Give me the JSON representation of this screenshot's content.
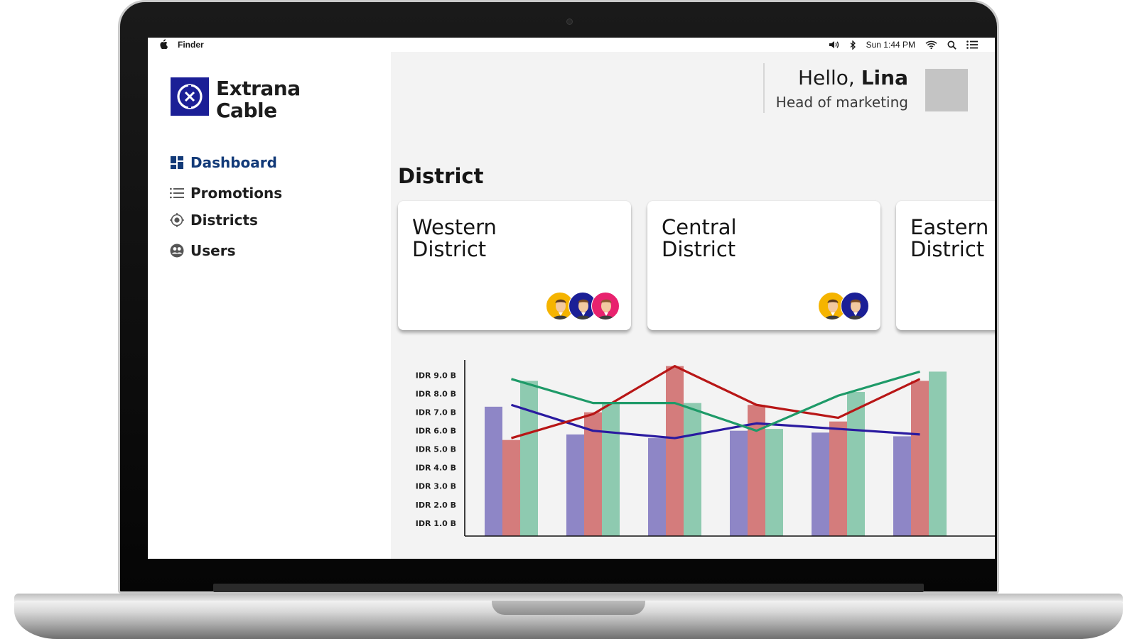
{
  "menubar": {
    "app_name": "Finder",
    "clock": "Sun 1:44 PM"
  },
  "sidebar": {
    "brand": {
      "line1": "Extrana",
      "line2": "Cable",
      "accent": "#1b1f96"
    },
    "items": [
      {
        "label": "Dashboard",
        "icon": "dashboard-grid-icon",
        "active": true
      },
      {
        "label": "Promotions",
        "icon": "list-icon",
        "active": false
      },
      {
        "label": "Districts",
        "icon": "target-icon",
        "active": false
      },
      {
        "label": "Users",
        "icon": "users-globe-icon",
        "active": false
      }
    ]
  },
  "header": {
    "greeting_prefix": "Hello, ",
    "user_name": "Lina",
    "user_role": "Head of marketing"
  },
  "district": {
    "title": "District",
    "cards": [
      {
        "line1": "Western",
        "line2": "District",
        "members": [
          "#f5b400",
          "#1b1f96",
          "#e8226e"
        ]
      },
      {
        "line1": "Central",
        "line2": "District",
        "members": [
          "#f5b400",
          "#1b1f96"
        ]
      },
      {
        "line1": "Eastern",
        "line2": "District",
        "members": []
      }
    ]
  },
  "chart_data": {
    "type": "bar",
    "y_ticks": [
      "IDR 1.0 B",
      "IDR 2.0 B",
      "IDR 3.0 B",
      "IDR 4.0 B",
      "IDR 5.0 B",
      "IDR 6.0 B",
      "IDR 7.0 B",
      "IDR 8.0 B",
      "IDR 9.0 B"
    ],
    "ylim": [
      0.3,
      9.6
    ],
    "group_count": 6,
    "series": [
      {
        "color": "#8e86c6",
        "values": [
          7.3,
          5.8,
          5.6,
          6.0,
          5.9,
          5.7
        ]
      },
      {
        "color": "#d47c7c",
        "values": [
          5.5,
          7.0,
          9.5,
          7.4,
          6.5,
          8.7
        ]
      },
      {
        "color": "#8ecab0",
        "values": [
          8.7,
          7.5,
          7.5,
          6.1,
          8.1,
          9.2
        ]
      }
    ],
    "lines": [
      {
        "color": "#2a1aa0",
        "values": [
          7.4,
          6.0,
          5.6,
          6.4,
          6.1,
          5.8
        ]
      },
      {
        "color": "#b81616",
        "values": [
          5.6,
          6.9,
          9.5,
          7.4,
          6.7,
          8.8
        ]
      },
      {
        "color": "#1e9a68",
        "values": [
          8.8,
          7.5,
          7.5,
          6.0,
          7.9,
          9.2
        ]
      }
    ]
  }
}
